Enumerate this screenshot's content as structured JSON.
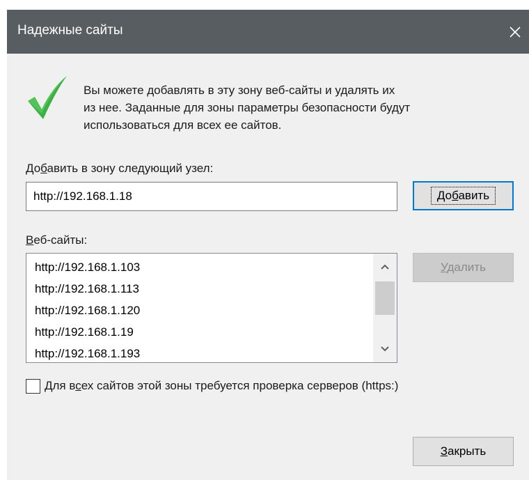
{
  "window": {
    "title": "Надежные сайты",
    "titlebar_color": "#585d61",
    "close_icon": "close-icon"
  },
  "intro": {
    "icon": "checkmark-icon",
    "icon_color": "#3cb043",
    "lines": [
      "Вы можете добавлять в эту зону  веб-сайты и удалять их",
      "из нее. Заданные для зоны параметры безопасности будут",
      "использоваться для всех ее сайтов."
    ]
  },
  "add_site": {
    "label_before": "До",
    "label_access": "б",
    "label_after": "авить в зону следующий узел:",
    "input_value": "http://192.168.1.18",
    "button_before": "До",
    "button_access": "б",
    "button_after": "авить"
  },
  "websites": {
    "label_access": "В",
    "label_after": "еб-сайты:",
    "items": [
      "http://192.168.1.103",
      "http://192.168.1.113",
      "http://192.168.1.120",
      "http://192.168.1.19",
      "http://192.168.1.193"
    ],
    "remove_access": "У",
    "remove_after": "далить"
  },
  "https_check": {
    "checked": false,
    "label_before": "Для в",
    "label_access": "с",
    "label_after": "ех сайтов этой зоны требуется проверка серверов (https:)"
  },
  "close_button": {
    "access": "З",
    "after": "акрыть"
  },
  "colors": {
    "accent": "#0078d7",
    "dialog_bg": "#f0f0f0"
  }
}
